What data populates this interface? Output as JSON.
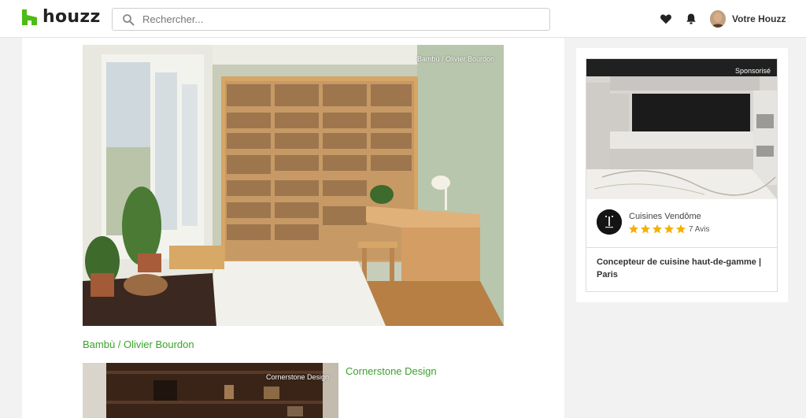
{
  "header": {
    "logo_text": "houzz",
    "search": {
      "placeholder": "Rechercher..."
    },
    "user_label": "Votre Houzz"
  },
  "feed": {
    "items": [
      {
        "photo_credit": "Bambù / Olivier Bourdon",
        "pro_name": "Bambù / Olivier Bourdon"
      },
      {
        "photo_credit": "Cornerstone Design",
        "pro_name": "Cornerstone Design"
      }
    ]
  },
  "sponsored_card": {
    "label": "Sponsorisé",
    "brand_name": "Cuisines Vendôme",
    "rating": 5,
    "reviews": "7 Avis",
    "description": "Concepteur de cuisine haut-de-gamme | Paris"
  },
  "colors": {
    "brand_green": "#3aa32a",
    "star_yellow": "#f5b000"
  }
}
